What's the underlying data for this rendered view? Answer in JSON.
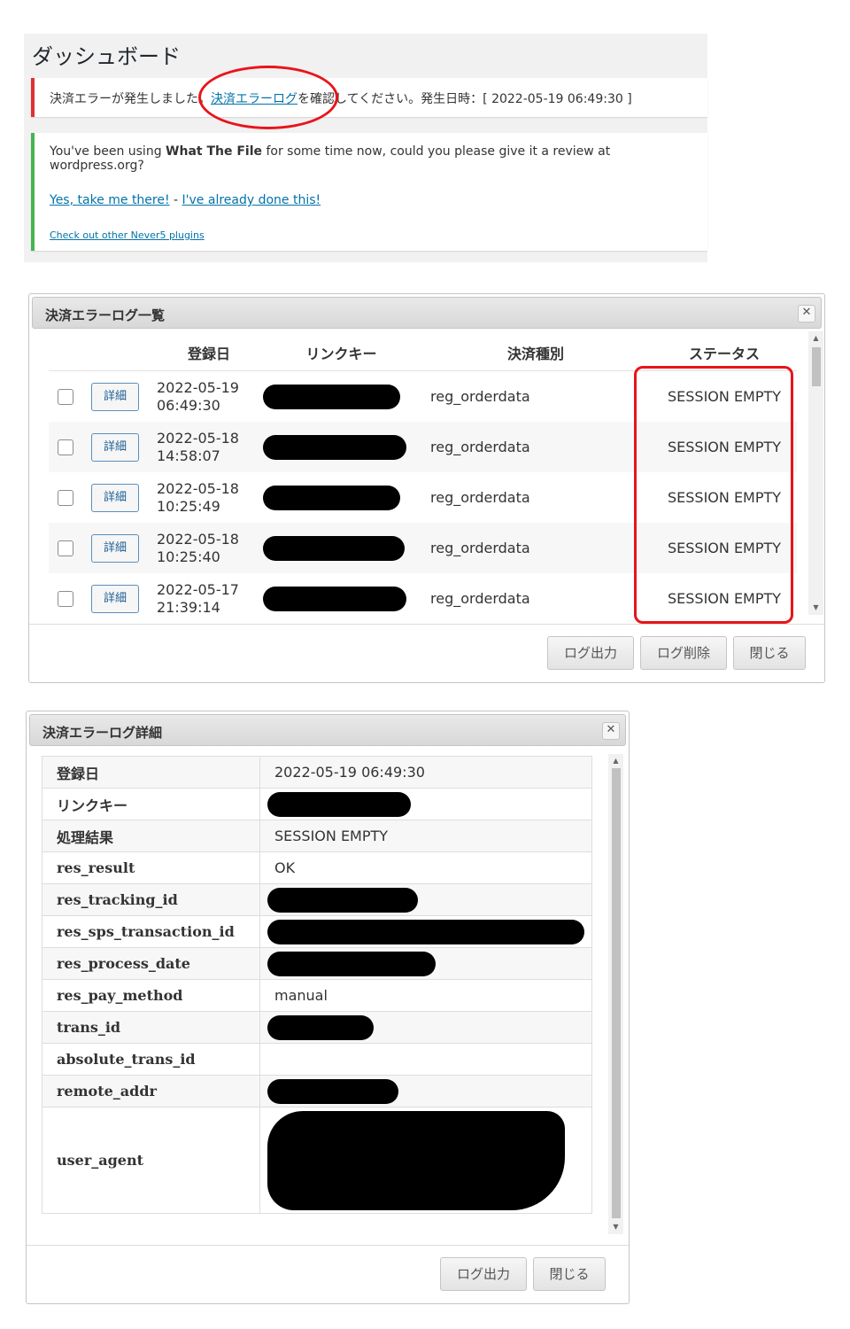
{
  "dashboard": {
    "title": "ダッシュボード",
    "error_notice": {
      "before": "決済エラーが発生しました。",
      "link": "決済エラーログ",
      "after": "を確認してください。発生日時：[ 2022-05-19 06:49:30 ]"
    },
    "review_notice": {
      "text_before": "You've been using ",
      "plugin_name": "What The File",
      "text_after": " for some time now, could you please give it a review at wordpress.org?",
      "link_yes": "Yes, take me there!",
      "separator": " - ",
      "link_done": "I've already done this!",
      "link_other": "Check out other Never5 plugins"
    }
  },
  "list_dialog": {
    "title": "決済エラーログ一覧",
    "columns": [
      "登録日",
      "リンクキー",
      "決済種別",
      "ステータス"
    ],
    "rows": [
      {
        "button": "詳細",
        "date": "2022-05-19",
        "time": "06:49:30",
        "type": "reg_orderdata",
        "status": "SESSION EMPTY"
      },
      {
        "button": "詳細",
        "date": "2022-05-18",
        "time": "14:58:07",
        "type": "reg_orderdata",
        "status": "SESSION EMPTY"
      },
      {
        "button": "詳細",
        "date": "2022-05-18",
        "time": "10:25:49",
        "type": "reg_orderdata",
        "status": "SESSION EMPTY"
      },
      {
        "button": "詳細",
        "date": "2022-05-18",
        "time": "10:25:40",
        "type": "reg_orderdata",
        "status": "SESSION EMPTY"
      },
      {
        "button": "詳細",
        "date": "2022-05-17",
        "time": "21:39:14",
        "type": "reg_orderdata",
        "status": "SESSION EMPTY"
      }
    ],
    "buttons": {
      "export": "ログ出力",
      "delete": "ログ削除",
      "close": "閉じる"
    }
  },
  "detail_dialog": {
    "title": "決済エラーログ詳細",
    "rows": [
      {
        "key": "登録日",
        "value": "2022-05-19 06:49:30"
      },
      {
        "key": "リンクキー",
        "value": ""
      },
      {
        "key": "処理結果",
        "value": "SESSION EMPTY"
      },
      {
        "key": "res_result",
        "value": "OK"
      },
      {
        "key": "res_tracking_id",
        "value": ""
      },
      {
        "key": "res_sps_transaction_id",
        "value": ""
      },
      {
        "key": "res_process_date",
        "value": ""
      },
      {
        "key": "res_pay_method",
        "value": "manual"
      },
      {
        "key": "trans_id",
        "value": ""
      },
      {
        "key": "absolute_trans_id",
        "value": ""
      },
      {
        "key": "remote_addr",
        "value": ""
      },
      {
        "key": "user_agent",
        "value": ""
      }
    ],
    "buttons": {
      "export": "ログ出力",
      "close": "閉じる"
    }
  },
  "icons": {
    "close": "close-icon",
    "scroll_up": "arrow-up-icon",
    "scroll_down": "arrow-down-icon"
  },
  "colors": {
    "error_border": "#dc3232",
    "success_border": "#46b450",
    "link": "#0073aa",
    "annotation": "#e8141a"
  }
}
